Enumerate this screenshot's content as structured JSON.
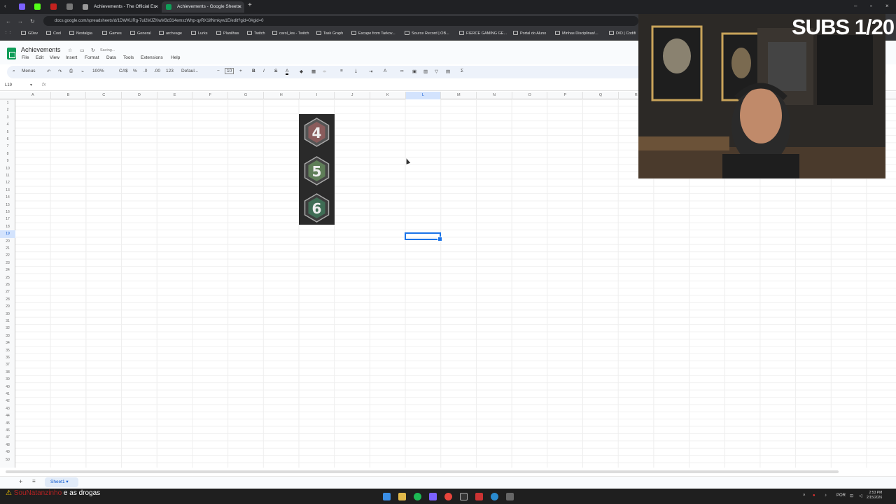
{
  "browser": {
    "tabs": [
      {
        "title": "Achievements - The Official Es",
        "active": false,
        "icon": "page-icon"
      },
      {
        "title": "Achievements - Google Sheets",
        "active": true,
        "icon": "sheets-icon"
      }
    ],
    "url": "docs.google.com/spreadsheets/d/1DWKURg-7ul2MJZKwM3d314emxzWhp-qyRX1ifNmkyw1E/edit?gid=0#gid=0",
    "bookmarks": [
      "GDev",
      "Cool",
      "Nostalgia",
      "Games",
      "General",
      "archeage",
      "Lurks",
      "Planilhas",
      "Twitch",
      "carol_les - Twitch",
      "Task Graph",
      "Escape from Tarkov...",
      "Source Record | OB...",
      "FIERCE GAMING GE...",
      "Portal do Aluno",
      "Minhas Disciplinas/...",
      "DIO | Codifi"
    ]
  },
  "doc": {
    "title": "Achievements",
    "status": "Saving...",
    "menus": [
      "File",
      "Edit",
      "View",
      "Insert",
      "Format",
      "Data",
      "Tools",
      "Extensions",
      "Help"
    ]
  },
  "toolbar": {
    "search": "Menus",
    "zoom": "100%",
    "currency": "CA$",
    "percent": "%",
    "dec_dec": ".0",
    "dec_inc": ".00",
    "format123": "123",
    "font": "Defaul...",
    "font_size": "10"
  },
  "formula_bar": {
    "name_box": "L19",
    "fx": "fx"
  },
  "grid": {
    "columns": [
      "A",
      "B",
      "C",
      "D",
      "E",
      "F",
      "G",
      "H",
      "I",
      "J",
      "K",
      "L",
      "M",
      "N",
      "O",
      "P",
      "Q",
      "R"
    ],
    "selected_column": "L",
    "selected_row": 19,
    "row_count": 50,
    "images": [
      {
        "badge": "4",
        "color": "#c98b8b"
      },
      {
        "badge": "5",
        "color": "#a9c9a0"
      },
      {
        "badge": "6",
        "color": "#b9d8c4"
      }
    ]
  },
  "sheets": [
    {
      "name": "Sheet1"
    }
  ],
  "stream": {
    "overlay": "SUBS 1/20",
    "chat_user": "SouNatanzinho",
    "chat_message": "e as drogas"
  },
  "taskbar": {
    "lang": "POR",
    "time": "2:53 PM",
    "date": "2/15/2026"
  }
}
